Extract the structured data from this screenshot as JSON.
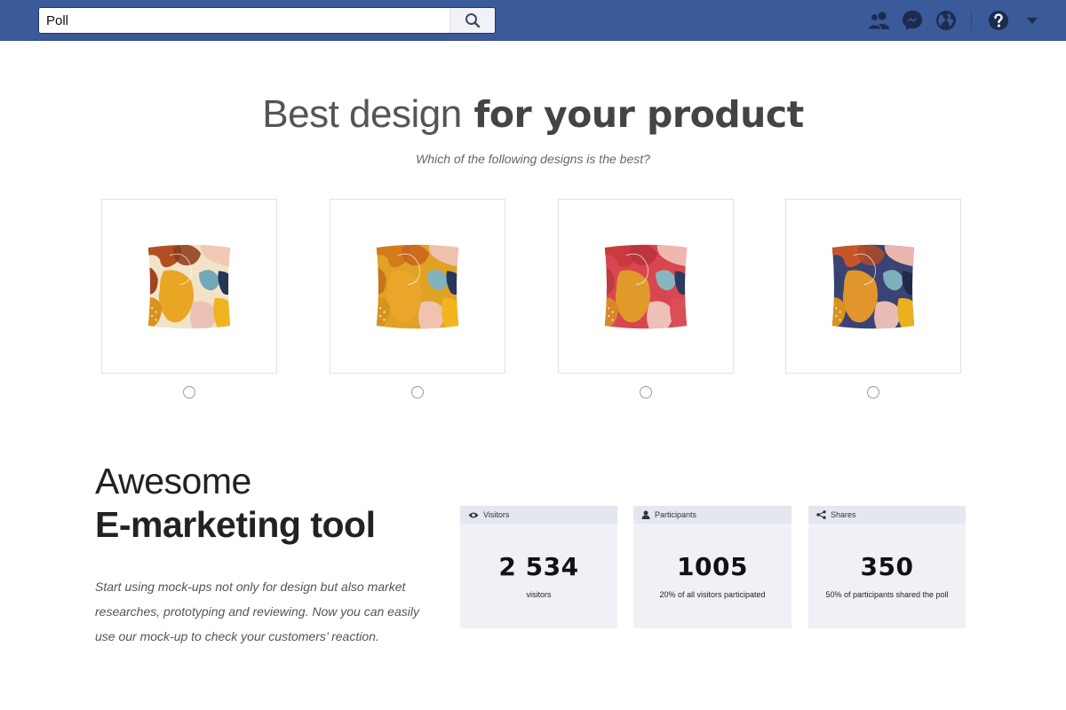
{
  "topbar": {
    "search_value": "Poll",
    "accent_color": "#3b5a9a",
    "icons": [
      "search-icon",
      "friends-icon",
      "messenger-icon",
      "globe-icon",
      "help-icon",
      "caret-down-icon"
    ]
  },
  "poll": {
    "title_light": "Best design",
    "title_bold": "for your product",
    "question": "Which of the following designs is the best?",
    "options": [
      {
        "name": "cream",
        "base_color": "#f2e3c8"
      },
      {
        "name": "mustard",
        "base_color": "#e0a224"
      },
      {
        "name": "red",
        "base_color": "#d8464f"
      },
      {
        "name": "navy",
        "base_color": "#3b4374"
      }
    ]
  },
  "promo": {
    "title_line1": "Awesome",
    "title_line2": "E-marketing tool",
    "description": "Start using mock-ups not only for design but also market researches, prototyping and reviewing. Now you can easily use our mock-up to check your customers’ reaction."
  },
  "stats": [
    {
      "label": "Visitors",
      "icon": "eye-icon",
      "value": "2 534",
      "caption": "visitors"
    },
    {
      "label": "Participants",
      "icon": "person-icon",
      "value": "1005",
      "caption": "20% of all visitors participated"
    },
    {
      "label": "Shares",
      "icon": "share-icon",
      "value": "350",
      "caption": "50% of participants shared the poll"
    }
  ]
}
